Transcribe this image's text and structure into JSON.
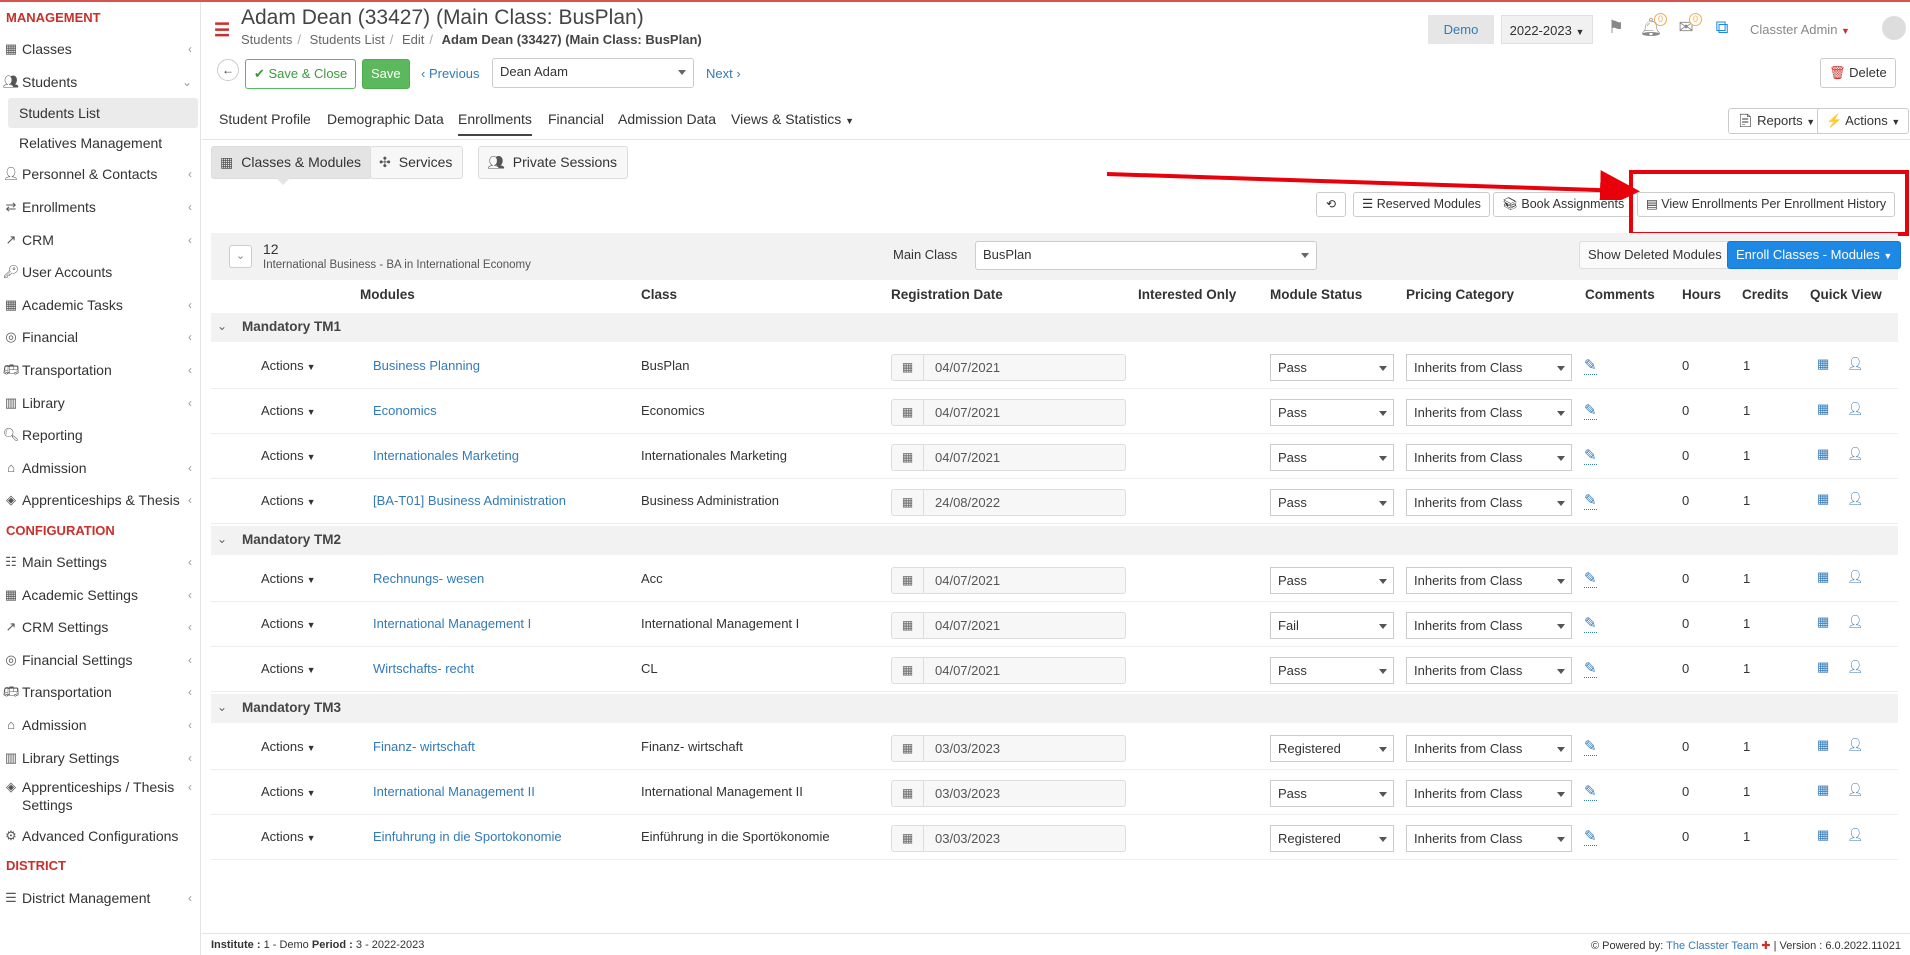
{
  "sidebar": {
    "management_title": "MANAGEMENT",
    "configuration_title": "CONFIGURATION",
    "district_title": "DISTRICT",
    "management_items": [
      {
        "label": "Classes",
        "icon": "classes-icon",
        "chevron": "‹"
      },
      {
        "label": "Students",
        "icon": "students-icon",
        "chevron": "⌄"
      },
      {
        "label": "Students List"
      },
      {
        "label": "Relatives Management"
      },
      {
        "label": "Personnel & Contacts",
        "icon": "personnel-icon",
        "chevron": "‹"
      },
      {
        "label": "Enrollments",
        "icon": "enrollments-icon",
        "chevron": "‹"
      },
      {
        "label": "CRM",
        "icon": "crm-icon",
        "chevron": "‹"
      },
      {
        "label": "User Accounts",
        "icon": "key-icon"
      },
      {
        "label": "Academic Tasks",
        "icon": "grid-icon",
        "chevron": "‹"
      },
      {
        "label": "Financial",
        "icon": "coins-icon",
        "chevron": "‹"
      },
      {
        "label": "Transportation",
        "icon": "bus-icon",
        "chevron": "‹"
      },
      {
        "label": "Library",
        "icon": "library-icon",
        "chevron": "‹"
      },
      {
        "label": "Reporting",
        "icon": "search-icon"
      },
      {
        "label": "Admission",
        "icon": "admission-icon",
        "chevron": "‹"
      },
      {
        "label": "Apprenticeships & Thesis",
        "icon": "cube-icon",
        "chevron": "‹"
      }
    ],
    "configuration_items": [
      {
        "label": "Main Settings",
        "icon": "sliders-icon",
        "chevron": "‹"
      },
      {
        "label": "Academic Settings",
        "icon": "grid-icon",
        "chevron": "‹"
      },
      {
        "label": "CRM Settings",
        "icon": "crm-icon",
        "chevron": "‹"
      },
      {
        "label": "Financial Settings",
        "icon": "coins-icon",
        "chevron": "‹"
      },
      {
        "label": "Transportation",
        "icon": "bus-icon",
        "chevron": "‹"
      },
      {
        "label": "Admission",
        "icon": "admission-icon",
        "chevron": "‹"
      },
      {
        "label": "Library Settings",
        "icon": "library-icon",
        "chevron": "‹"
      },
      {
        "label": "Apprenticeships / Thesis Settings",
        "icon": "cube-icon",
        "chevron": "‹"
      },
      {
        "label": "Advanced Configurations",
        "icon": "gears-icon"
      }
    ],
    "district_items": [
      {
        "label": "District Management",
        "icon": "list-icon",
        "chevron": "‹"
      }
    ]
  },
  "header": {
    "title": "Adam Dean (33427) (Main Class: BusPlan)",
    "breadcrumb": [
      "Students",
      "Students List",
      "Edit",
      "Adam Dean (33427) (Main Class: BusPlan)"
    ],
    "demo_badge": "Demo",
    "year": "2022-2023",
    "notif_count": "0",
    "mail_count": "0",
    "user": "Classter Admin"
  },
  "toolbar": {
    "save_close": "Save & Close",
    "save": "Save",
    "previous": "Previous",
    "student_select": "Dean Adam",
    "next": "Next",
    "delete": "Delete"
  },
  "tabs": [
    "Student Profile",
    "Demographic Data",
    "Enrollments",
    "Financial",
    "Admission Data",
    "Views & Statistics"
  ],
  "tab_actions": {
    "reports": "Reports",
    "actions": "Actions"
  },
  "subtabs": [
    "Classes & Modules",
    "Services",
    "Private Sessions"
  ],
  "action_bar": {
    "reserved_modules": "Reserved Modules",
    "book_assignments": "Book Assignments",
    "view_enrollments_history": "View Enrollments Per Enrollment History"
  },
  "summary": {
    "number": "12",
    "program": "International Business - BA in International Economy",
    "main_class_label": "Main Class",
    "main_class_value": "BusPlan",
    "show_deleted": "Show Deleted Modules",
    "enroll": "Enroll Classes - Modules"
  },
  "columns": [
    "Modules",
    "Class",
    "Registration Date",
    "Interested Only",
    "Module Status",
    "Pricing Category",
    "Comments",
    "Hours",
    "Credits",
    "Quick View"
  ],
  "groups": [
    {
      "name": "Mandatory TM1",
      "rows": [
        {
          "actions": "Actions",
          "module": "Business Planning",
          "class": "BusPlan",
          "date": "04/07/2021",
          "status": "Pass",
          "pricing": "Inherits from Class",
          "hours": "0",
          "credits": "1"
        },
        {
          "actions": "Actions",
          "module": "Economics",
          "class": "Economics",
          "date": "04/07/2021",
          "status": "Pass",
          "pricing": "Inherits from Class",
          "hours": "0",
          "credits": "1"
        },
        {
          "actions": "Actions",
          "module": "Internationales Marketing",
          "class": "Internationales Marketing",
          "date": "04/07/2021",
          "status": "Pass",
          "pricing": "Inherits from Class",
          "hours": "0",
          "credits": "1"
        },
        {
          "actions": "Actions",
          "module": "[BA-T01] Business Administration",
          "class": "Business Administration",
          "date": "24/08/2022",
          "status": "Pass",
          "pricing": "Inherits from Class",
          "hours": "0",
          "credits": "1"
        }
      ]
    },
    {
      "name": "Mandatory TM2",
      "rows": [
        {
          "actions": "Actions",
          "module": "Rechnungs- wesen",
          "class": "Acc",
          "date": "04/07/2021",
          "status": "Pass",
          "pricing": "Inherits from Class",
          "hours": "0",
          "credits": "1"
        },
        {
          "actions": "Actions",
          "module": "International Management I",
          "class": "International Management I",
          "date": "04/07/2021",
          "status": "Fail",
          "pricing": "Inherits from Class",
          "hours": "0",
          "credits": "1"
        },
        {
          "actions": "Actions",
          "module": "Wirtschafts- recht",
          "class": "CL",
          "date": "04/07/2021",
          "status": "Pass",
          "pricing": "Inherits from Class",
          "hours": "0",
          "credits": "1"
        }
      ]
    },
    {
      "name": "Mandatory TM3",
      "rows": [
        {
          "actions": "Actions",
          "module": "Finanz- wirtschaft",
          "class": "Finanz- wirtschaft",
          "date": "03/03/2023",
          "status": "Registered",
          "pricing": "Inherits from Class",
          "hours": "0",
          "credits": "1"
        },
        {
          "actions": "Actions",
          "module": "International Management II",
          "class": "International Management II",
          "date": "03/03/2023",
          "status": "Pass",
          "pricing": "Inherits from Class",
          "hours": "0",
          "credits": "1"
        },
        {
          "actions": "Actions",
          "module": "Einfuhrung in die Sportokonomie",
          "class": "Einführung in die Sportökonomie",
          "date": "03/03/2023",
          "status": "Registered",
          "pricing": "Inherits from Class",
          "hours": "0",
          "credits": "1"
        }
      ]
    }
  ],
  "footer": {
    "institute_label": "Institute :",
    "institute_value": "1 - Demo",
    "period_label": "Period :",
    "period_value": "3 - 2022-2023",
    "powered_by": "Powered by:",
    "team": "The Classter Team",
    "version": "| Version : 6.0.2022.11021"
  },
  "colors": {
    "accent_red": "#c9302c",
    "link_blue": "#337ab7",
    "primary_blue": "#1e88e5",
    "save_green": "#5cb85c",
    "highlight_red": "#e8000b"
  }
}
